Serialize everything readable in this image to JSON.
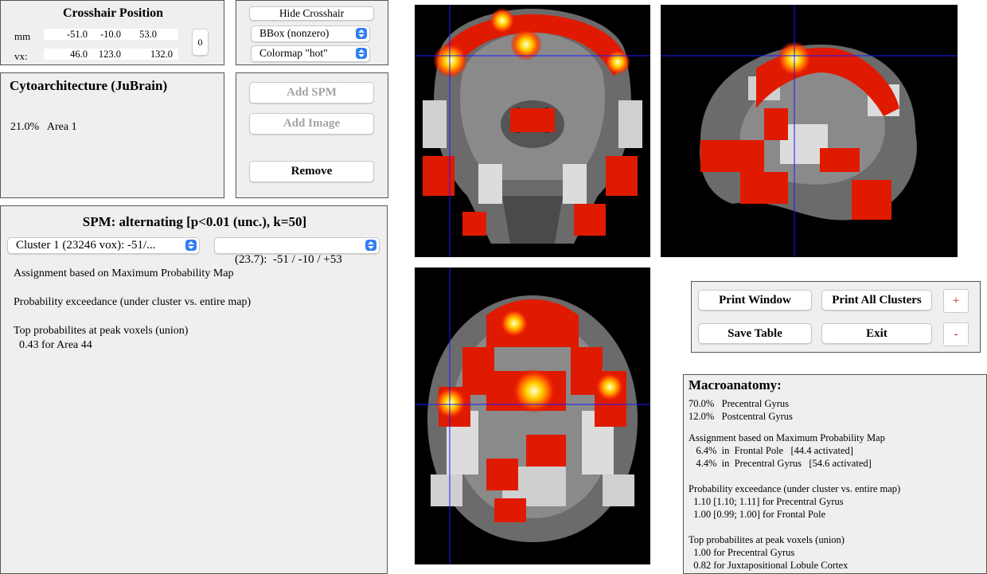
{
  "crosshair": {
    "title": "Crosshair Position",
    "mm_label": "mm",
    "vx_label": "vx:",
    "mm": [
      "-51.0",
      "-10.0",
      "53.0"
    ],
    "vx": [
      "46.0",
      "123.0",
      "132.0"
    ],
    "zero_label": "0"
  },
  "display": {
    "hide_crosshair_label": "Hide Crosshair",
    "bbox_select": "BBox (nonzero)",
    "colormap_select": "Colormap \"hot\""
  },
  "cyto": {
    "title": "Cytoarchitecture (JuBrain)",
    "value": "21.0%   Area 1"
  },
  "actions": {
    "add_spm": "Add SPM",
    "add_image": "Add Image",
    "remove": "Remove"
  },
  "spm": {
    "title": "SPM: alternating [p<0.01 (unc.), k=50]",
    "cluster_select": "Cluster 1 (23246 vox): -51/...",
    "peak_select": "(23.7):  -51 / -10 / +53",
    "assignment": "Assignment based on Maximum Probability Map",
    "exceedance": "Probability exceedance (under cluster vs. entire map)",
    "top_title": "Top probabilites at peak voxels (union)",
    "top_value": "  0.43 for Area 44"
  },
  "buttons": {
    "print_window": "Print Window",
    "print_all": "Print All Clusters",
    "plus": "+",
    "save_table": "Save Table",
    "exit": "Exit",
    "minus": "-"
  },
  "macro": {
    "title": "Macroanatomy:",
    "lines": [
      "70.0%   Precentral Gyrus",
      "12.0%   Postcentral Gyrus",
      "Assignment based on Maximum Probability Map",
      "   6.4%  in  Frontal Pole   [44.4 activated]",
      "   4.4%  in  Precentral Gyrus   [54.6 activated]",
      "Probability exceedance (under cluster vs. entire map)",
      "  1.10 [1.10; 1.11] for Precentral Gyrus",
      "  1.00 [0.99; 1.00] for Frontal Pole",
      "Top probabilites at peak voxels (union)",
      "  1.00 for Precentral Gyrus",
      "  0.82 for Juxtapositional Lobule Cortex"
    ]
  },
  "colors": {
    "crosshair": "#1a1aff",
    "hot_low": "#e01000",
    "hot_mid": "#ff6a00",
    "hot_high": "#ffff70",
    "select_accent": "#2f7df6"
  }
}
